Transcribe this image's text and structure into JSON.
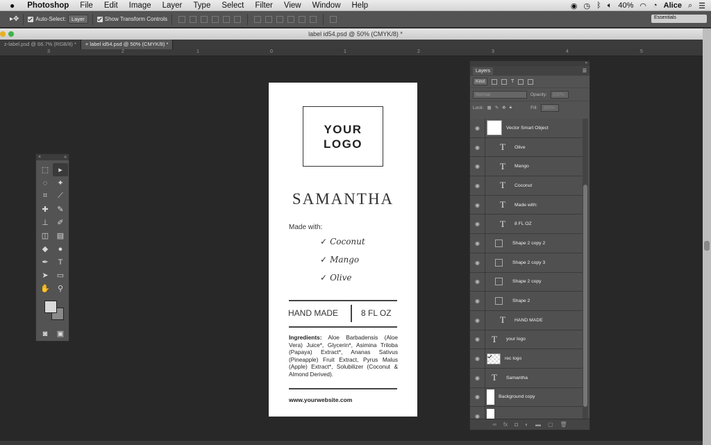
{
  "menubar": {
    "apple": "",
    "app": "Photoshop",
    "items": [
      "File",
      "Edit",
      "Image",
      "Layer",
      "Type",
      "Select",
      "Filter",
      "View",
      "Window",
      "Help"
    ],
    "battery": "40%",
    "user": "Alice"
  },
  "options_bar": {
    "auto_select_label": "Auto-Select:",
    "auto_select_value": "Layer",
    "transform_label": "Show Transform Controls",
    "workspace": "Essentials"
  },
  "window": {
    "title": "label id54.psd @ 50% (CMYK/8) *"
  },
  "tabs": [
    {
      "label": "z-label.psd @ 66.7% (RGB/8) *",
      "active": false
    },
    {
      "label": "label id54.psd @ 50% (CMYK/8) *",
      "active": true
    }
  ],
  "ruler": [
    "3",
    "2",
    "1",
    "0",
    "1",
    "2",
    "3",
    "4",
    "5"
  ],
  "document": {
    "logo_line1": "YOUR",
    "logo_line2": "LOGO",
    "brand": "SAMANTHA",
    "made_with": "Made with:",
    "ingredients_list": [
      "Coconut",
      "Mango",
      "Olive"
    ],
    "check": "✓",
    "hand_made": "HAND MADE",
    "size": "8 FL OZ",
    "ingredients_label": "Ingredients:",
    "ingredients_text": " Aloe Barbadensis (Aloe Vera) Juice*, Glycerin*, Asimina Triloba (Papaya) Extract*, Ananas Sativus (Pineapple) Fruit Extract, Pyrus Malus (Apple) Extract*, Solubilizer (Coconut & Almond Derived).",
    "website": "www.yourwebsite.com"
  },
  "layers_panel": {
    "title": "Layers",
    "kind": "Kind",
    "blend": "Normal",
    "opacity_label": "Opacity:",
    "opacity_value": "100%",
    "lock_label": "Lock:",
    "fill_label": "Fill:",
    "fill_value": "100%",
    "layers": [
      {
        "name": "Vector Smart Object",
        "type": "vector"
      },
      {
        "name": "Olive",
        "type": "text",
        "indent": true
      },
      {
        "name": "Mango",
        "type": "text",
        "indent": true
      },
      {
        "name": "Coconut",
        "type": "text",
        "indent": true
      },
      {
        "name": "Made with:",
        "type": "text",
        "indent": true
      },
      {
        "name": "8 FL OZ",
        "type": "text",
        "indent": true
      },
      {
        "name": "Shape 2 copy 2",
        "type": "shape"
      },
      {
        "name": "Shape 2 copy 3",
        "type": "shape"
      },
      {
        "name": "Shape 2 copy",
        "type": "shape"
      },
      {
        "name": "Shape 2",
        "type": "shape"
      },
      {
        "name": "HAND MADE",
        "type": "text",
        "indent": true
      },
      {
        "name": "your logo",
        "type": "text"
      },
      {
        "name": "rec logo",
        "type": "checker"
      },
      {
        "name": "Samantha",
        "type": "text"
      },
      {
        "name": "Background copy",
        "type": "image"
      },
      {
        "name": "",
        "type": "image"
      }
    ]
  }
}
